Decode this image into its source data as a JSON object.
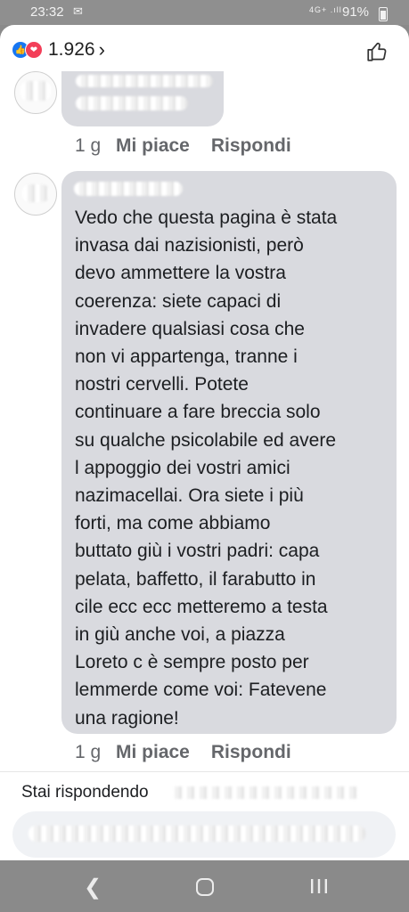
{
  "status": {
    "time": "23:32",
    "network": "4G+ .ıll",
    "battery": "91%"
  },
  "reactions": {
    "count": "1.926",
    "icons": [
      "like-icon",
      "love-icon"
    ]
  },
  "comment_prev": {
    "time": "1 g",
    "like": "Mi piace",
    "reply": "Rispondi"
  },
  "comment_main": {
    "text": "Vedo che questa pagina è stata\ninvasa dai nazisionisti,  però\ndevo ammettere la vostra\ncoerenza: siete capaci di\ninvadere qualsiasi cosa che\nnon vi appartenga,  tranne i\nnostri cervelli.  Potete\ncontinuare a fare breccia solo\nsu qualche psicolabile ed avere\nl appoggio dei vostri amici\nnazimacellai. Ora siete i più\nforti,  ma come abbiamo\nbuttato giù i vostri padri: capa\npelata, baffetto,  il farabutto in\ncile ecc ecc metteremo a testa\nin giù anche voi, a piazza\nLoreto c è sempre posto per\nlemmerde come voi: Fatevene\nuna ragione!",
    "time": "1 g",
    "like": "Mi piace",
    "reply": "Rispondi"
  },
  "reply_bar": {
    "replying_label": "Stai rispondendo"
  },
  "colors": {
    "facebook_blue": "#1877f2",
    "love_red": "#f33e58",
    "bubble": "#d9dadf",
    "action_gray": "#65676b"
  }
}
